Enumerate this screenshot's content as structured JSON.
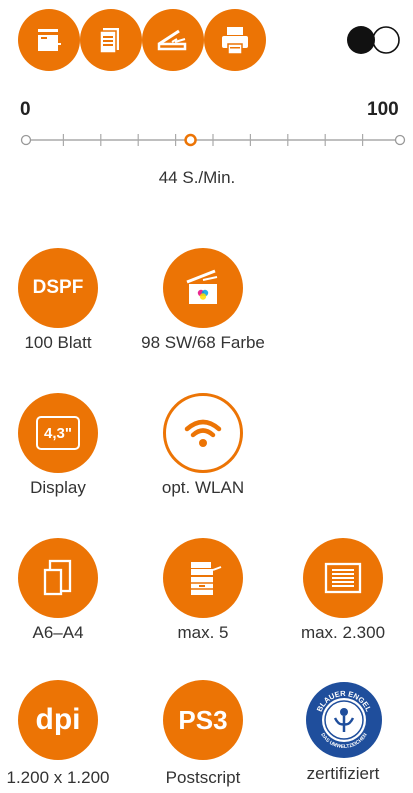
{
  "mode_icons": [
    {
      "icon": "copier-icon"
    },
    {
      "icon": "documents-icon"
    },
    {
      "icon": "scanner-icon"
    },
    {
      "icon": "printer-icon"
    }
  ],
  "toggle": {
    "state": "off",
    "icon": "toggle-icon"
  },
  "speed_slider": {
    "min_label": "0",
    "max_label": "100",
    "value": 44,
    "value_label": "44 S./Min."
  },
  "features": [
    {
      "badge": "DSPF",
      "caption": "100 Blatt",
      "icon": "dspf-icon"
    },
    {
      "badge": "",
      "caption": "98 SW/68 Farbe",
      "icon": "color-scan-icon"
    },
    {
      "badge": "4,3\"",
      "caption": "Display",
      "icon": "display-icon"
    },
    {
      "badge": "",
      "caption": "opt. WLAN",
      "icon": "wifi-icon"
    },
    {
      "badge": "",
      "caption": "A6–A4",
      "icon": "paper-size-icon"
    },
    {
      "badge": "",
      "caption": "max. 5",
      "icon": "paper-trays-icon"
    },
    {
      "badge": "",
      "caption": "max. 2.300",
      "icon": "paper-capacity-icon"
    },
    {
      "badge": "dpi",
      "caption": "1.200 x 1.200",
      "icon": "dpi-icon"
    },
    {
      "badge": "PS3",
      "caption": "Postscript",
      "icon": "postscript-icon"
    },
    {
      "badge": "BLAUER ENGEL",
      "badge_bottom": "DAS UMWELTZEICHEN",
      "caption": "zertifiziert",
      "icon": "blue-angel-seal-icon"
    }
  ],
  "colors": {
    "accent": "#ec7405",
    "seal": "#1f4e9c"
  }
}
